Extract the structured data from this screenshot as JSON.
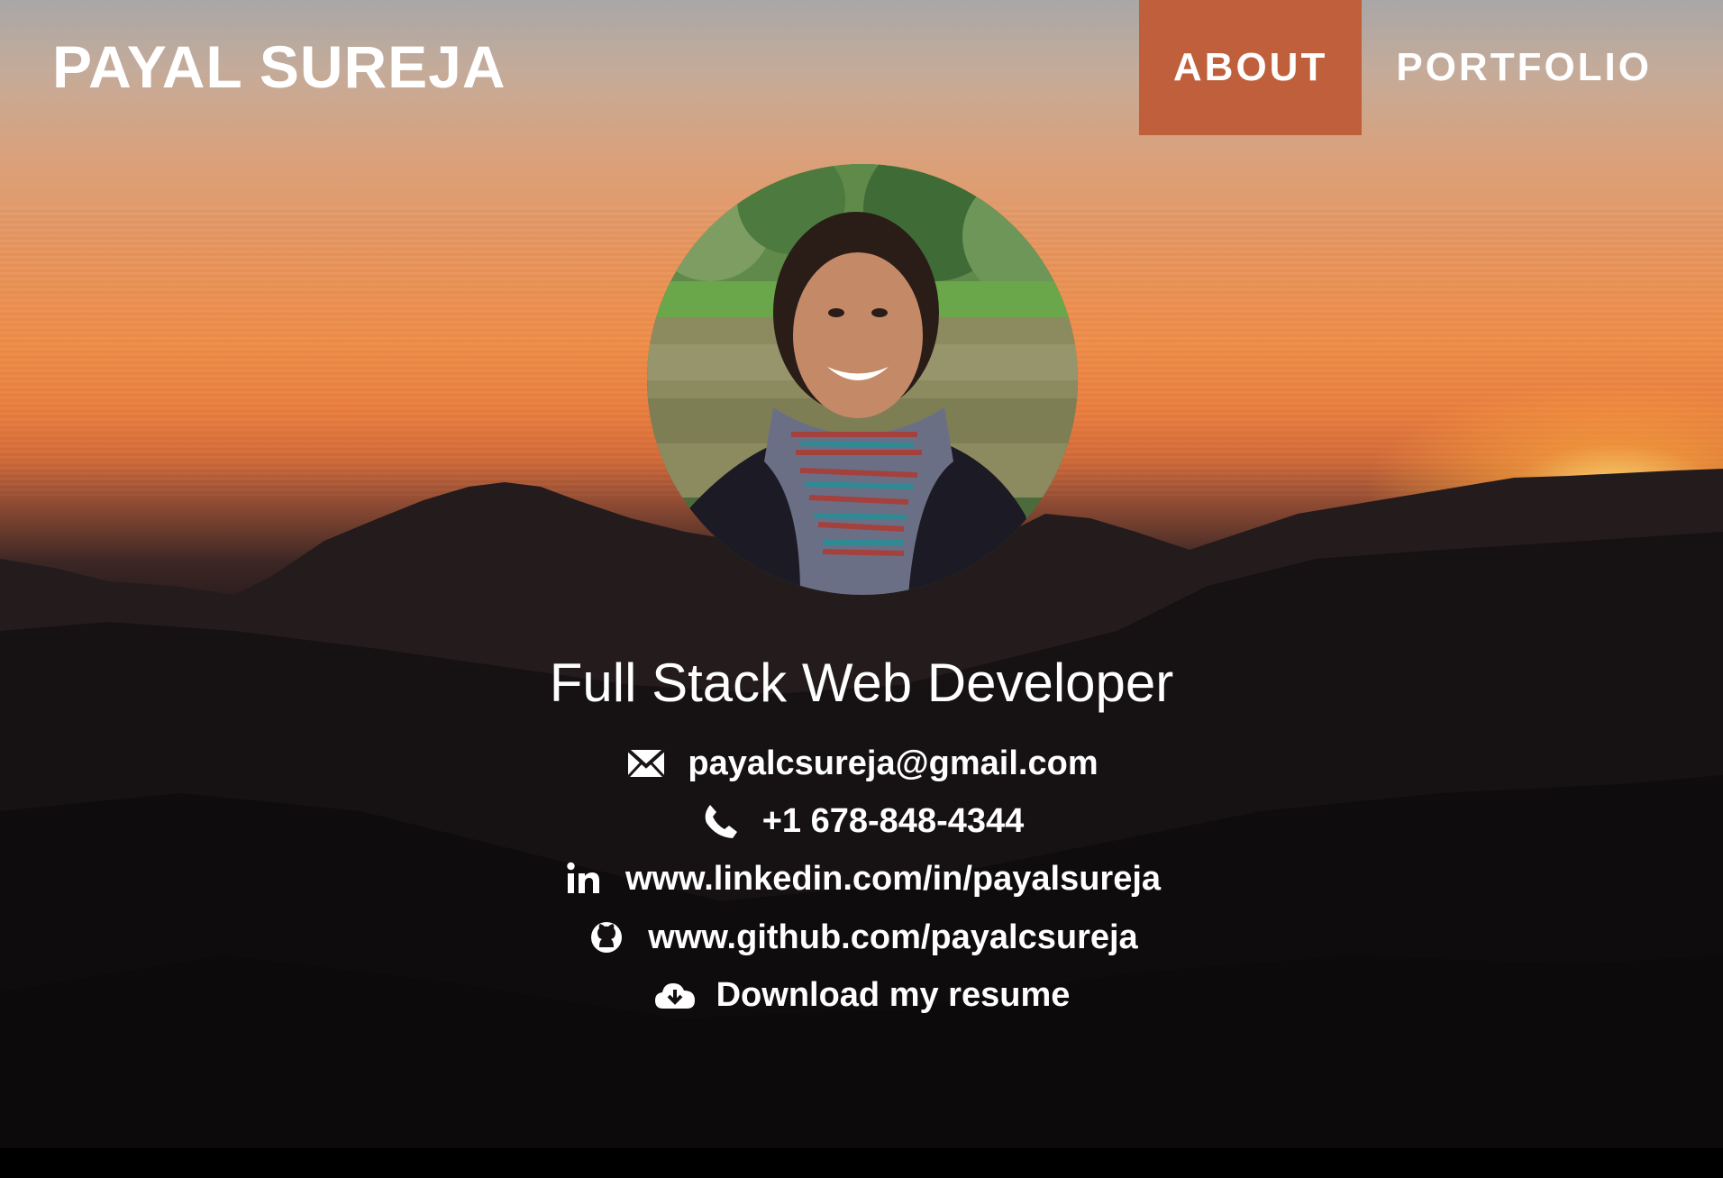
{
  "header": {
    "brand": "PAYAL SUREJA",
    "nav": [
      {
        "label": "ABOUT",
        "active": true
      },
      {
        "label": "PORTFOLIO",
        "active": false
      }
    ]
  },
  "profile": {
    "photo_alt": "",
    "tagline": "Full Stack Web Developer"
  },
  "contacts": [
    {
      "icon": "envelope-icon",
      "text": "payalcsureja@gmail.com"
    },
    {
      "icon": "phone-icon",
      "text": "+1 678-848-4344"
    },
    {
      "icon": "linkedin-icon",
      "text": "www.linkedin.com/in/payalsureja"
    },
    {
      "icon": "github-icon",
      "text": "www.github.com/payalcsureja"
    },
    {
      "icon": "cloud-download-icon",
      "text": "Download my resume"
    }
  ],
  "colors": {
    "accent": "#bf5f3b",
    "text": "#ffffff"
  }
}
